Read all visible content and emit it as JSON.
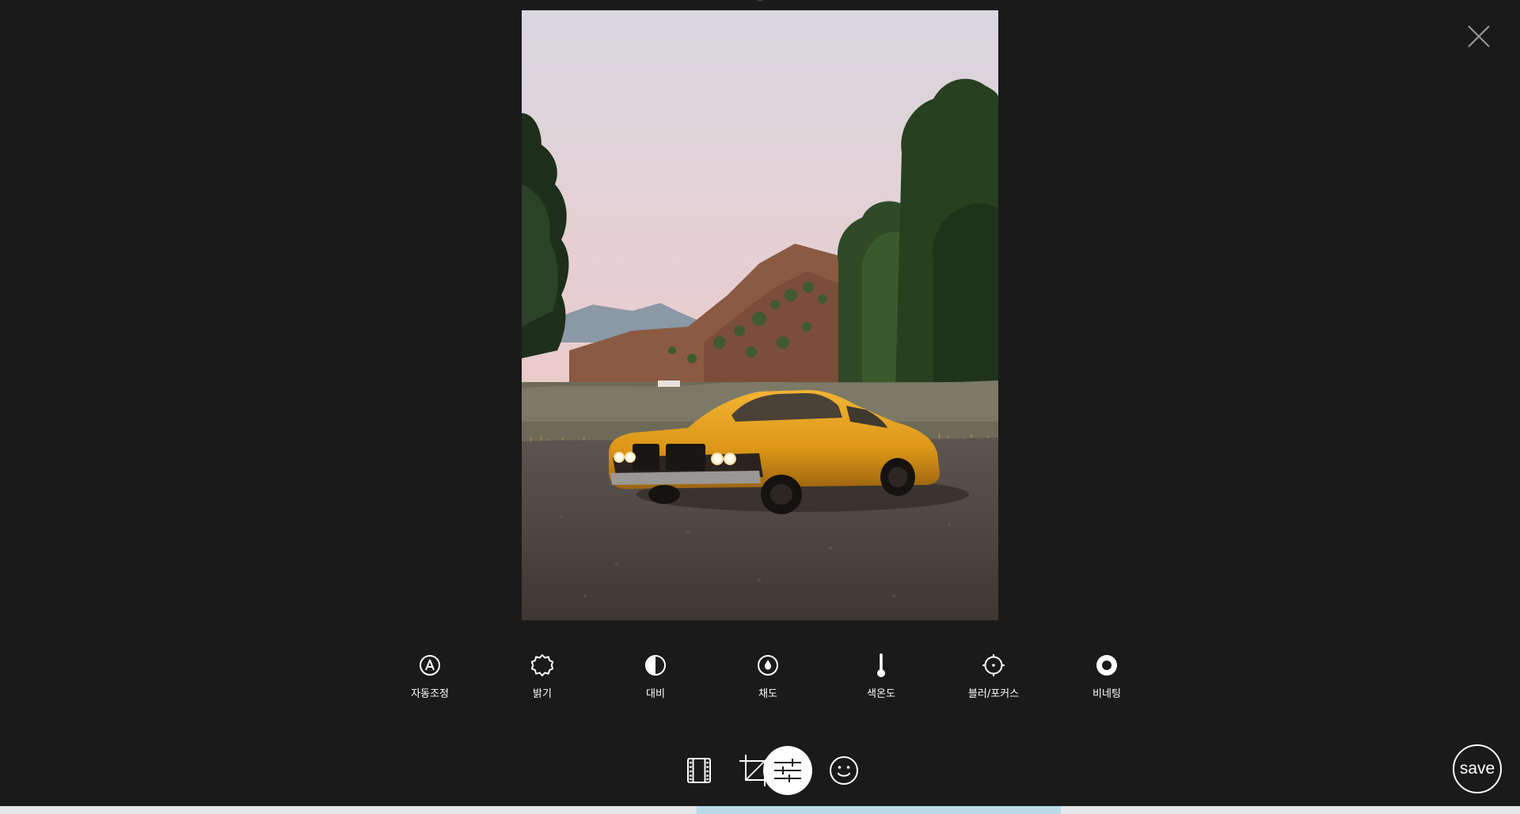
{
  "close": {
    "icon": "close-icon"
  },
  "photo": {
    "subject": "yellow-classic-car-photo"
  },
  "adjustments": [
    {
      "icon": "auto-adjust-icon",
      "label": "자동조정"
    },
    {
      "icon": "brightness-icon",
      "label": "밝기"
    },
    {
      "icon": "contrast-icon",
      "label": "대비"
    },
    {
      "icon": "saturation-drop-icon",
      "label": "채도"
    },
    {
      "icon": "thermometer-icon",
      "label": "색온도"
    },
    {
      "icon": "focus-target-icon",
      "label": "블러/포커스"
    },
    {
      "icon": "vignette-icon",
      "label": "비네팅"
    }
  ],
  "tools": [
    {
      "icon": "filter-film-icon",
      "active": false
    },
    {
      "icon": "crop-icon",
      "active": false
    },
    {
      "icon": "adjust-sliders-icon",
      "active": true
    },
    {
      "icon": "sticker-smiley-icon",
      "active": false
    }
  ],
  "save": {
    "label": "save"
  },
  "colors": {
    "background": "#1a1a1b",
    "active_tool_bg": "#ffffff",
    "text": "#ffffff"
  }
}
